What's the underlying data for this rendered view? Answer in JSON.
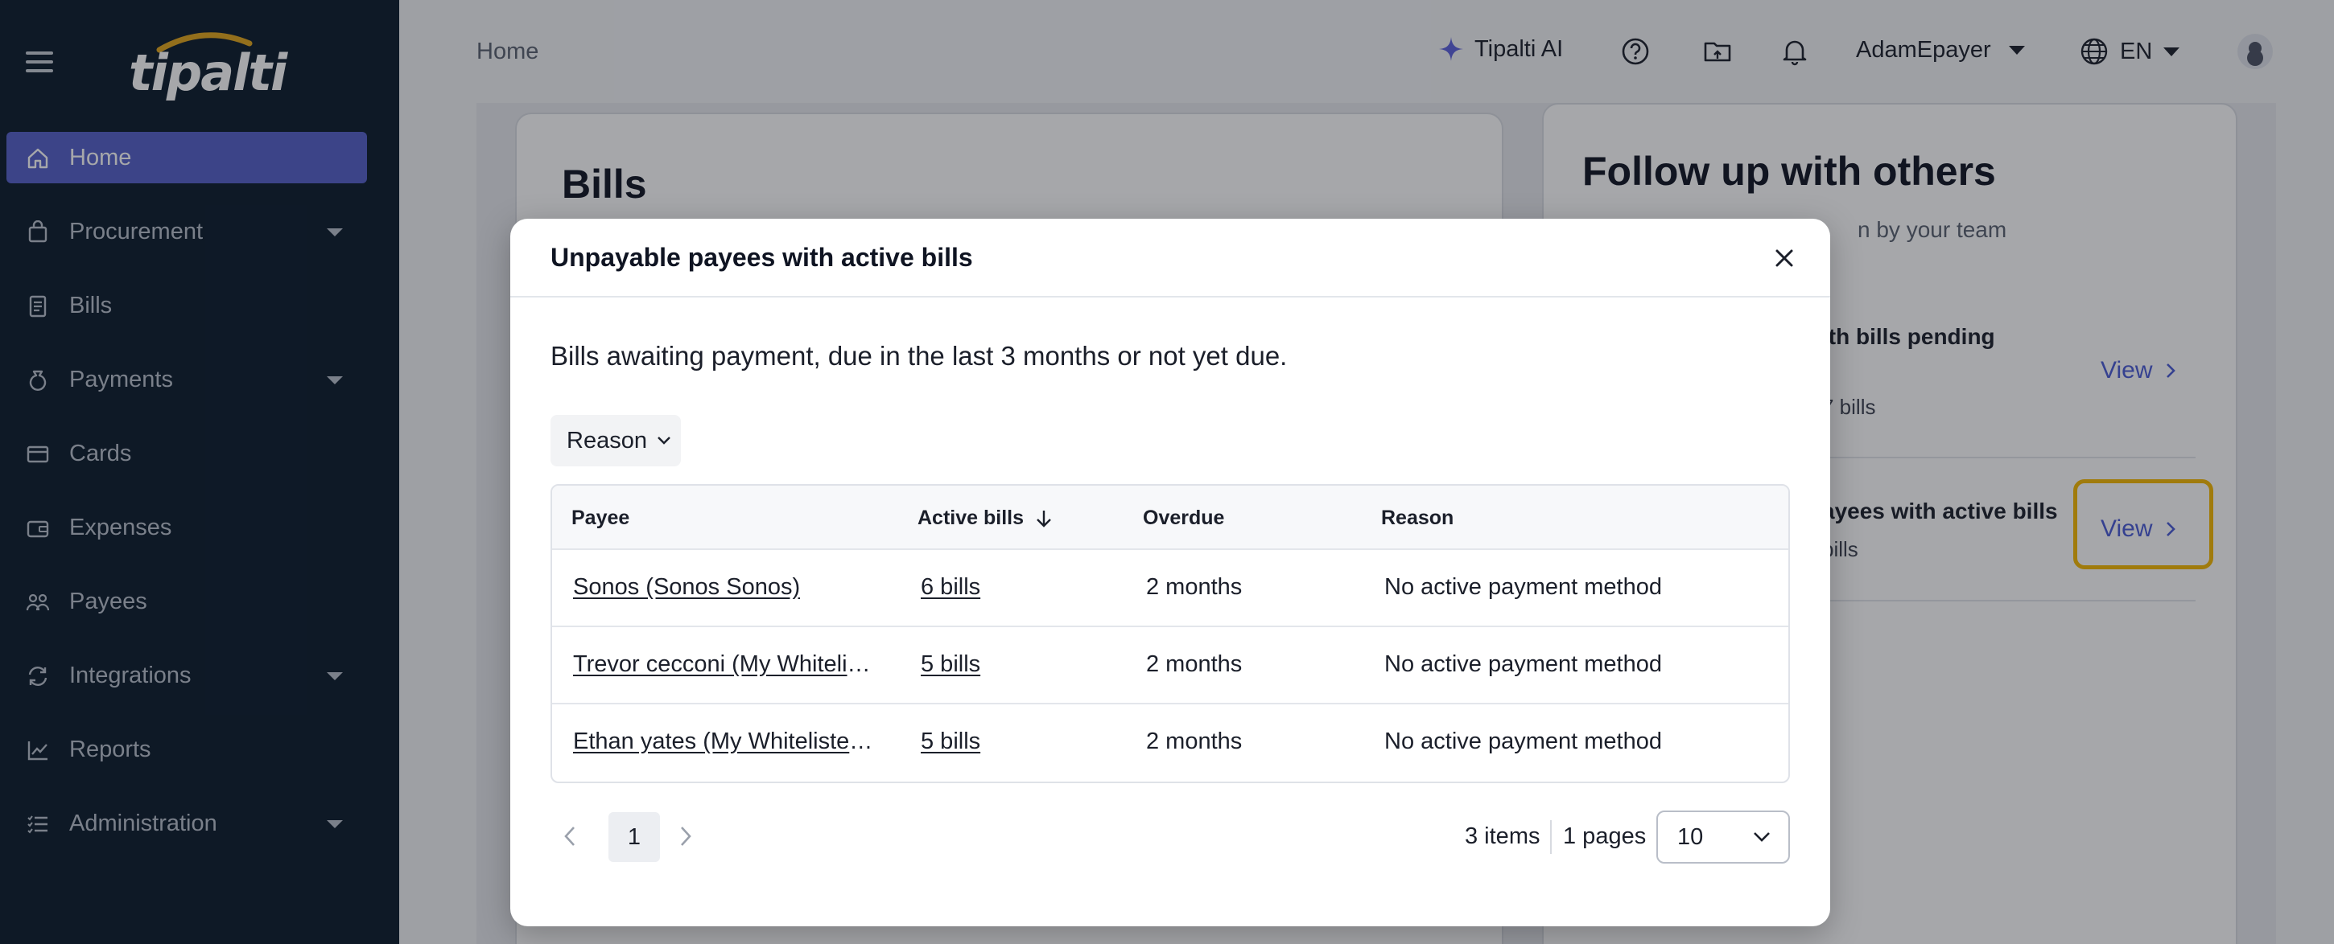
{
  "sidebar": {
    "brand": "tipalti",
    "items": [
      {
        "label": "Home",
        "icon": "home-icon",
        "active": true,
        "expandable": false
      },
      {
        "label": "Procurement",
        "icon": "shopping-bag-icon",
        "expandable": true
      },
      {
        "label": "Bills",
        "icon": "document-icon",
        "expandable": false
      },
      {
        "label": "Payments",
        "icon": "money-bag-icon",
        "expandable": true
      },
      {
        "label": "Cards",
        "icon": "credit-card-icon",
        "expandable": false
      },
      {
        "label": "Expenses",
        "icon": "wallet-icon",
        "expandable": false
      },
      {
        "label": "Payees",
        "icon": "people-icon",
        "expandable": false
      },
      {
        "label": "Integrations",
        "icon": "sync-icon",
        "expandable": true
      },
      {
        "label": "Reports",
        "icon": "chart-icon",
        "expandable": false
      },
      {
        "label": "Administration",
        "icon": "list-settings-icon",
        "expandable": true
      }
    ]
  },
  "topbar": {
    "breadcrumb": "Home",
    "ai_label": "Tipalti AI",
    "user_name": "AdamEpayer",
    "language": "EN"
  },
  "bills_card": {
    "title": "Bills"
  },
  "follow_card": {
    "title": "Follow up with others",
    "subtitle": "n by your team",
    "rows": [
      {
        "title": "ith bills pending",
        "detail": "7 bills",
        "link": "View"
      },
      {
        "title": "ayees with active bills",
        "detail": "bills",
        "link": "View"
      }
    ]
  },
  "modal": {
    "title": "Unpayable payees with active bills",
    "description": "Bills awaiting payment, due in the last 3 months or not yet due.",
    "filter_label": "Reason",
    "columns": {
      "payee": "Payee",
      "active_bills": "Active bills",
      "overdue": "Overdue",
      "reason": "Reason"
    },
    "rows": [
      {
        "payee": "Sonos (Sonos Sonos)",
        "active_bills": "6 bills",
        "overdue": "2 months",
        "reason": "No active payment method"
      },
      {
        "payee": "Trevor cecconi (My Whitelisted Payee)",
        "active_bills": "5 bills",
        "overdue": "2 months",
        "reason": "No active payment method"
      },
      {
        "payee": "Ethan yates (My Whitelisted Payee)",
        "active_bills": "5 bills",
        "overdue": "2 months",
        "reason": "No active payment method"
      }
    ],
    "pagination": {
      "current_page": "1",
      "items_text": "3 items",
      "pages_text": "1 pages",
      "page_size": "10"
    }
  },
  "colors": {
    "sidebar_bg": "#0b1a2b",
    "active_nav": "#5460c9",
    "link": "#4a5bd6",
    "highlight": "#f5b800",
    "ai_accent": "#5b5fdc"
  }
}
